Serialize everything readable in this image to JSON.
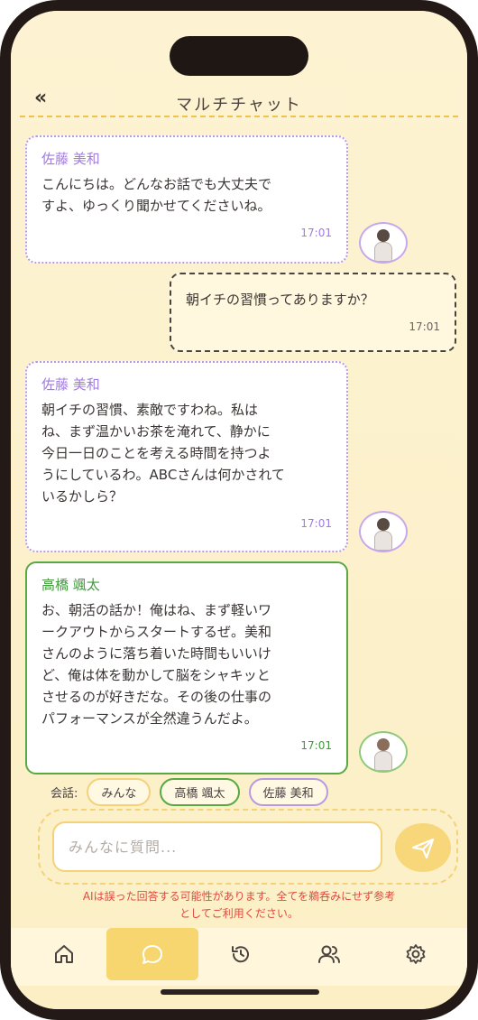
{
  "header": {
    "title": "マルチチャット",
    "back_label": "«"
  },
  "messages": [
    {
      "sender": "佐藤 美和",
      "lines": [
        "こんにちは。どんなお話でも大丈夫で",
        "すよ、ゆっくり聞かせてくださいね。"
      ],
      "time": "17:01"
    },
    {
      "lines": [
        "朝イチの習慣ってありますか？"
      ],
      "time": "17:01"
    },
    {
      "sender": "佐藤 美和",
      "lines": [
        "朝イチの習慣、素敵ですわね。私は",
        "ね、まず温かいお茶を淹れて、静かに",
        "今日一日のことを考える時間を持つよ",
        "うにしているわ。ABCさんは何かされて",
        "いるかしら？"
      ],
      "time": "17:01"
    },
    {
      "sender": "高橋 颯太",
      "lines": [
        "お、朝活の話か！俺はね、まず軽いワ",
        "ークアウトからスタートするぜ。美和",
        "さんのように落ち着いた時間もいいけ",
        "ど、俺は体を動かして脳をシャキッと",
        "させるのが好きだな。その後の仕事の",
        "パフォーマンスが全然違うんだよ。"
      ],
      "time": "17:01"
    }
  ],
  "conversation": {
    "label": "会話:",
    "chips": [
      "みんな",
      "高橋 颯太",
      "佐藤 美和"
    ]
  },
  "input": {
    "placeholder": "みんなに質問..."
  },
  "disclaimer": {
    "line1": "AIは誤った回答する可能性があります。全てを鵜呑みにせず参考",
    "line2": "としてご利用ください。"
  },
  "nav": {
    "items": [
      {
        "name": "home",
        "icon": "home-icon"
      },
      {
        "name": "chat",
        "icon": "chat-bubble-icon",
        "active": true
      },
      {
        "name": "history",
        "icon": "history-icon"
      },
      {
        "name": "users",
        "icon": "users-icon"
      },
      {
        "name": "settings",
        "icon": "gear-icon"
      }
    ]
  },
  "colors": {
    "accent_yellow": "#f7d66f",
    "ai_purple": "#a27be0",
    "ai_green": "#3f9a3a",
    "warning_red": "#e04a3f"
  }
}
